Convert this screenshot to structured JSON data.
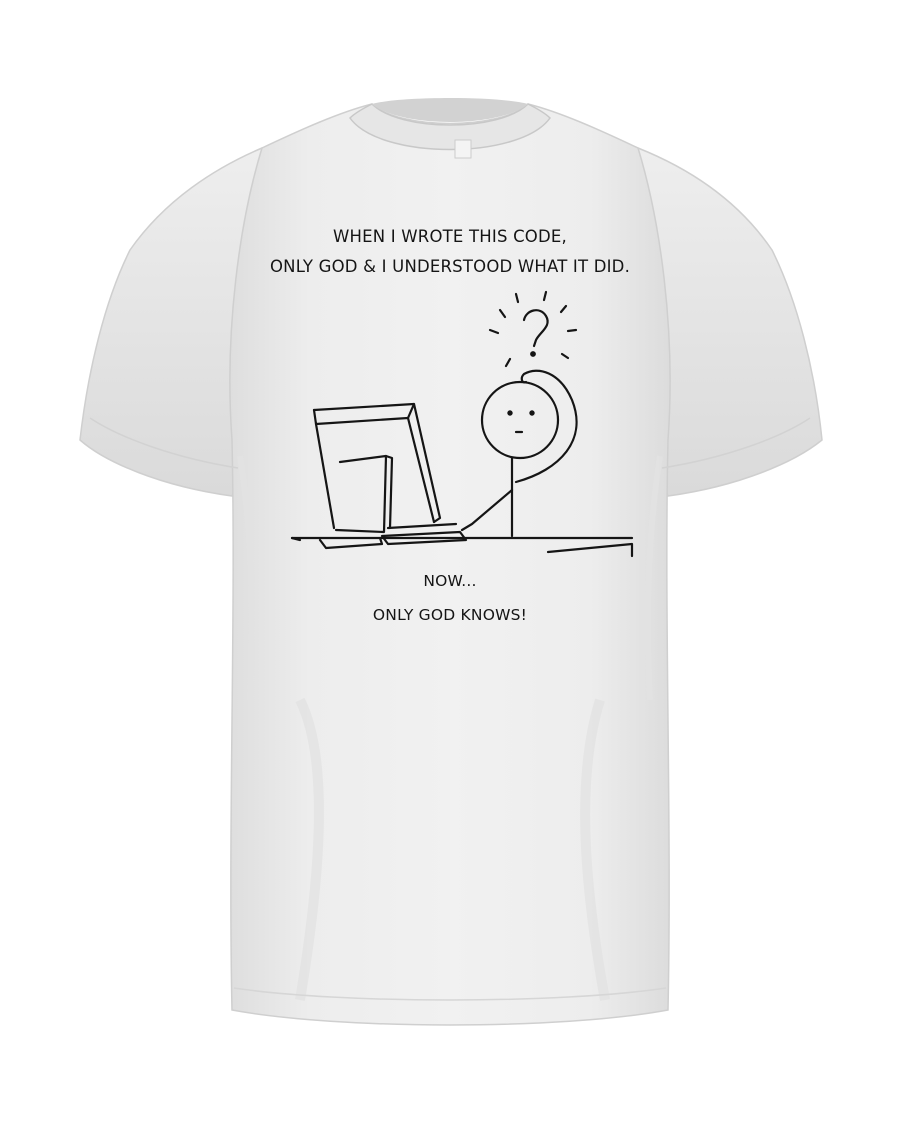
{
  "shirt": {
    "color": "#ececec",
    "shade_color": "#d4d4d4",
    "ink_color": "#151515"
  },
  "print": {
    "top_lines": [
      "WHEN I WROTE THIS CODE,",
      "ONLY GOD & I UNDERSTOOD WHAT IT DID."
    ],
    "bottom_lines": [
      "NOW...",
      "ONLY GOD KNOWS!"
    ],
    "illustration": {
      "question_mark": "?",
      "icons": [
        "stick-figure-icon",
        "computer-monitor-icon",
        "desk-icon",
        "question-mark-icon"
      ]
    }
  }
}
